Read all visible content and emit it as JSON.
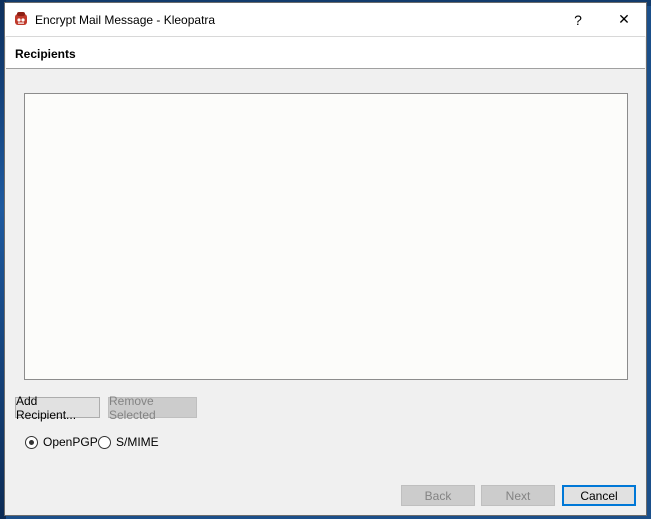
{
  "window": {
    "title": "Encrypt Mail Message - Kleopatra",
    "help_label": "?",
    "close_label": "✕"
  },
  "header": {
    "title": "Recipients"
  },
  "actions": {
    "add_recipient_label": "Add Recipient...",
    "remove_selected_label": "Remove Selected"
  },
  "protocol": {
    "options": [
      {
        "label": "OpenPGP",
        "checked": true
      },
      {
        "label": "S/MIME",
        "checked": false
      }
    ]
  },
  "wizard": {
    "back_label": "Back",
    "next_label": "Next",
    "cancel_label": "Cancel"
  },
  "colors": {
    "accent": "#0078d7",
    "app_icon": "#c0392b"
  }
}
